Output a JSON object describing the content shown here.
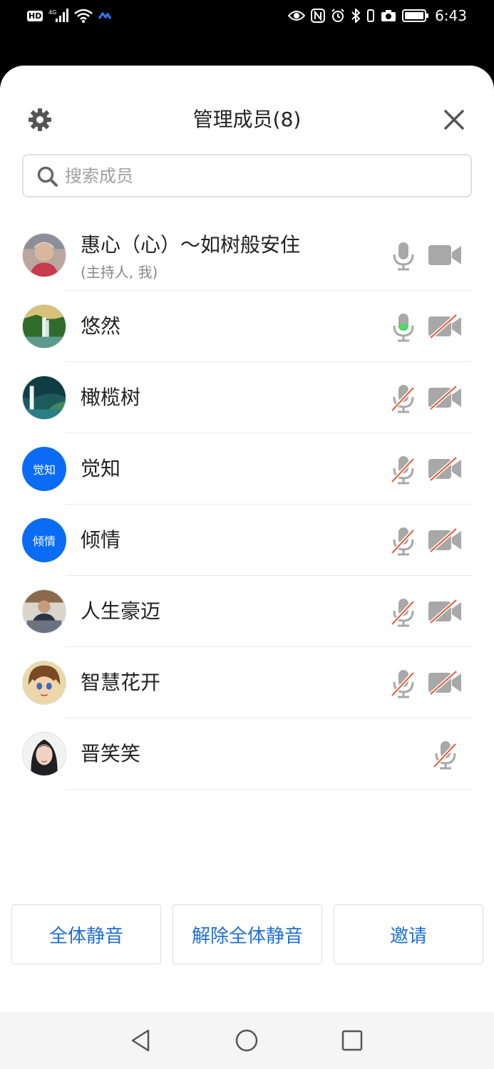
{
  "status_bar": {
    "hd": "HD",
    "network": "4G",
    "time": "6:43"
  },
  "header": {
    "title": "管理成员(8)",
    "settings_icon": "gear-icon",
    "close_icon": "close-icon"
  },
  "search": {
    "placeholder": "搜索成员",
    "value": ""
  },
  "members": [
    {
      "name": "惠心（心）～如树般安住",
      "subtitle": "(主持人, 我)",
      "avatar": "photo",
      "mic": "on",
      "camera": "on"
    },
    {
      "name": "悠然",
      "avatar": "photo",
      "mic": "speaking",
      "camera": "off"
    },
    {
      "name": "橄榄树",
      "avatar": "photo",
      "mic": "off",
      "camera": "off"
    },
    {
      "name": "觉知",
      "avatar_text": "觉知",
      "avatar": "text",
      "mic": "off",
      "camera": "off"
    },
    {
      "name": "倾情",
      "avatar_text": "倾情",
      "avatar": "text",
      "mic": "off",
      "camera": "off"
    },
    {
      "name": "人生豪迈",
      "avatar": "photo",
      "mic": "off",
      "camera": "off"
    },
    {
      "name": "智慧花开",
      "avatar": "photo",
      "mic": "off",
      "camera": "off"
    },
    {
      "name": "晋笑笑",
      "avatar": "photo",
      "mic": "off",
      "camera": "none"
    }
  ],
  "actions": {
    "mute_all": "全体静音",
    "unmute_all": "解除全体静音",
    "invite": "邀请"
  },
  "colors": {
    "accent": "#1f6fd6",
    "avatar_blue": "#0a6cf5",
    "muted_slash": "#e4572e",
    "speaking": "#4cd964",
    "icon_gray": "#a8a8a8"
  }
}
